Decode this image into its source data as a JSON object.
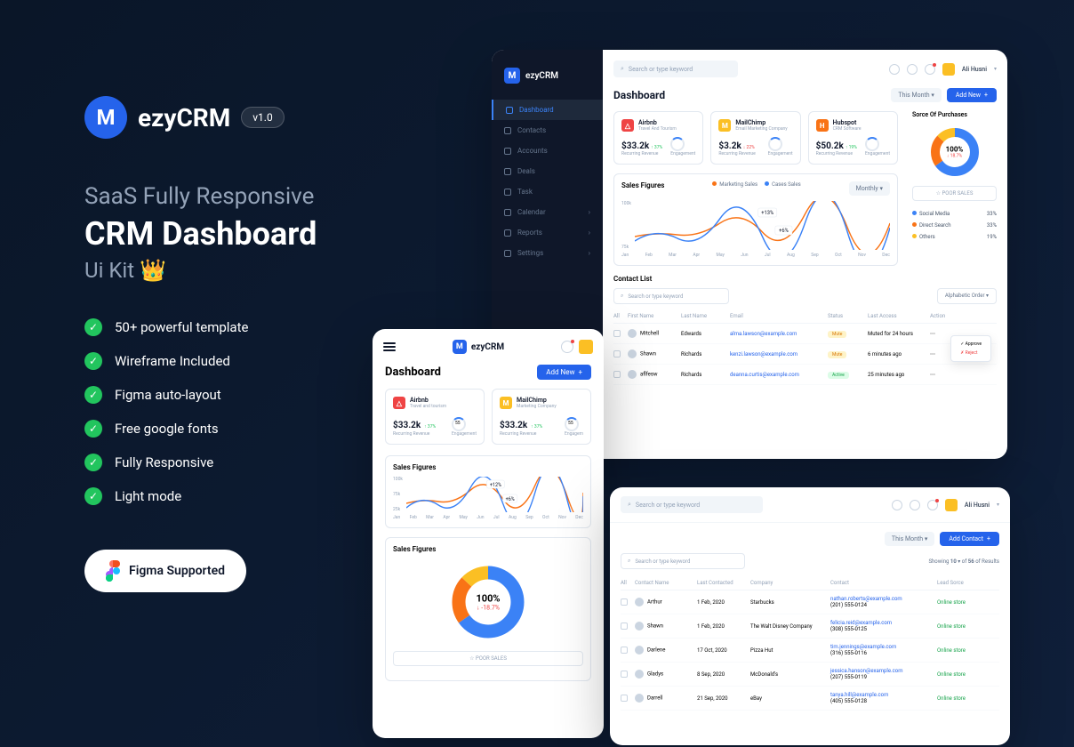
{
  "hero": {
    "logo": "ezyCRM",
    "version": "v1.0",
    "subtitle": "SaaS Fully Responsive",
    "title": "CRM Dashboard",
    "kit": "Ui Kit 👑",
    "features": [
      "50+ powerful template",
      "Wireframe Included",
      "Figma auto-layout",
      "Free google fonts",
      "Fully Responsive",
      "Light mode"
    ],
    "figma": "Figma Supported"
  },
  "desktop": {
    "brand": "ezyCRM",
    "sidebar": [
      "Dashboard",
      "Contacts",
      "Accounts",
      "Deals",
      "Task",
      "Calendar",
      "Reports",
      "Settings"
    ],
    "search": "Search or type keyword",
    "user": "Ali Husni",
    "title": "Dashboard",
    "period": "This Month",
    "addBtn": "Add New",
    "cards": [
      {
        "name": "Airbnb",
        "sub": "Travel And Tourism",
        "val": "$33.2k",
        "delta": "↑ 37%",
        "dir": "up",
        "lbl": "Recurring Revenue",
        "eng": "Engagement"
      },
      {
        "name": "MailChimp",
        "sub": "Email Marketing Company",
        "val": "$3.2k",
        "delta": "↓ 22%",
        "dir": "down",
        "lbl": "Recurring Revenue",
        "eng": "Engagement"
      },
      {
        "name": "Hubspot",
        "sub": "CRM Software",
        "val": "$50.2k",
        "delta": "↑ 19%",
        "dir": "up",
        "lbl": "Recurring Revenue",
        "eng": "Engagement"
      }
    ],
    "chart": {
      "title": "Sales Figures",
      "leg1": "Marketing Sales",
      "leg2": "Cases Sales",
      "dd": "Monthly",
      "yticks": [
        "100k",
        "75k"
      ],
      "tip1": "+13%",
      "tip2": "+6%",
      "months": [
        "Jan",
        "Feb",
        "Mar",
        "Apr",
        "May",
        "Jun",
        "Jul",
        "Aug",
        "Sep",
        "Oct",
        "Nov",
        "Dec"
      ]
    },
    "donut": {
      "title": "Sorce Of Purchases",
      "pct": "100%",
      "sub": "↓ 18.7%",
      "poor": "☆ POOR SALES",
      "rows": [
        {
          "n": "Social Media",
          "v": "33%"
        },
        {
          "n": "Direct Search",
          "v": "33%"
        },
        {
          "n": "Others",
          "v": "19%"
        }
      ]
    },
    "contacts": {
      "title": "Contact List",
      "search": "Search or type keyword",
      "filter": "Alphabetic Order",
      "cols": [
        "All",
        "First Name",
        "Last Name",
        "Email",
        "Status",
        "Last Access",
        "Action"
      ],
      "rows": [
        {
          "fn": "Mitchell",
          "ln": "Edwards",
          "em": "alma.lawson@example.com",
          "st": "Mute",
          "la": "Muted for 24 hours"
        },
        {
          "fn": "Shawn",
          "ln": "Richards",
          "em": "kenzi.lawson@example.com",
          "st": "Mute",
          "la": "6 minutes ago"
        },
        {
          "fn": "aflfesw",
          "ln": "Richards",
          "em": "deanna.curtis@example.com",
          "st": "Active",
          "la": "25 minutes ago"
        }
      ],
      "popup": {
        "a": "✓ Approve",
        "b": "✗ Reject"
      }
    }
  },
  "mobile": {
    "brand": "ezyCRM",
    "title": "Dashboard",
    "addBtn": "Add New",
    "cards": [
      {
        "name": "Airbnb",
        "sub": "Travel and tourism",
        "val": "$33.2k",
        "delta": "↑ 37%",
        "lbl": "Recurring Revenue",
        "eng": "Engagement",
        "score": "55"
      },
      {
        "name": "MailChimp",
        "sub": "Marketing Company",
        "val": "$33.2k",
        "delta": "↑ 37%",
        "lbl": "Recurring Revenue",
        "eng": "Engagem",
        "score": "55"
      }
    ],
    "chart": {
      "title": "Sales Figures",
      "yticks": [
        "100k",
        "75k",
        "25k"
      ],
      "tip1": "+12%",
      "tip2": "+6%",
      "months": [
        "Jan",
        "Feb",
        "Mar",
        "Apr",
        "May",
        "Jun",
        "Jul",
        "Aug",
        "Sep",
        "Oct",
        "Nov",
        "Dec"
      ]
    },
    "donut": {
      "title": "Sales Figures",
      "pct": "100%",
      "sub": "↓ -18.7%",
      "poor": "☆ POOR SALES"
    }
  },
  "bottom": {
    "search": "Search or type keyword",
    "user": "Ali Husni",
    "period": "This Month",
    "addBtn": "Add Contact",
    "results": {
      "a": "Showing",
      "n1": "10",
      "b": "of",
      "n2": "56",
      "c": "of Results"
    },
    "listSearch": "Search or type keyword",
    "cols": [
      "All",
      "Contact Name",
      "Last Contacted",
      "Company",
      "Contact",
      "Lead Sorce"
    ],
    "rows": [
      {
        "nm": "Arthur",
        "dt": "1 Feb, 2020",
        "co": "Starbucks",
        "em": "nathan.roberts@example.com",
        "ph": "(201) 555-0124",
        "ls": "Online store"
      },
      {
        "nm": "Shawn",
        "dt": "1 Feb, 2020",
        "co": "The Walt Disney Company",
        "em": "felicia.reid@example.com",
        "ph": "(308) 555-0125",
        "ls": "Online store"
      },
      {
        "nm": "Darlene",
        "dt": "17 Oct, 2020",
        "co": "Pizza Hut",
        "em": "tim.jennings@example.com",
        "ph": "(316) 555-0116",
        "ls": "Online store"
      },
      {
        "nm": "Gladys",
        "dt": "8 Sep, 2020",
        "co": "McDonald's",
        "em": "jessica.hanson@example.com",
        "ph": "(207) 555-0119",
        "ls": "Online store"
      },
      {
        "nm": "Darrell",
        "dt": "21 Sep, 2020",
        "co": "eBay",
        "em": "tanya.hill@example.com",
        "ph": "(405) 555-0128",
        "ls": "Online store"
      }
    ]
  }
}
